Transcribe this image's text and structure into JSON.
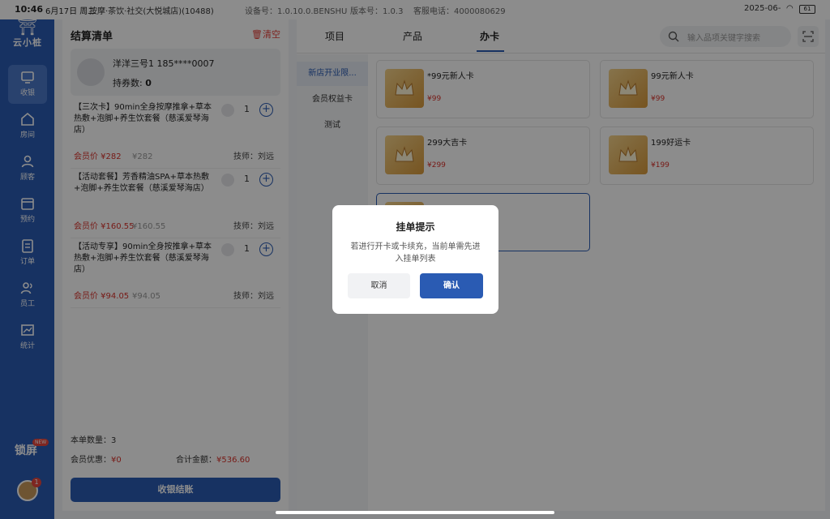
{
  "status_bar": {
    "time": "10:46",
    "date": "6月17日 周二",
    "store": "按摩·茶饮·社交(大悦城店)(10488)",
    "device": "设备号：1.0.10.0.BENSHU",
    "version": "版本号：1.0.3",
    "phone": "客服电话：4000080629",
    "right_date": "2025-06-",
    "battery": "61"
  },
  "sidebar": {
    "logo": "云小桩",
    "items": [
      {
        "label": "收银",
        "icon": "monitor-icon",
        "active": true
      },
      {
        "label": "房间",
        "icon": "home-icon"
      },
      {
        "label": "顾客",
        "icon": "person-icon"
      },
      {
        "label": "预约",
        "icon": "calendar-icon"
      },
      {
        "label": "订单",
        "icon": "clipboard-icon"
      },
      {
        "label": "员工",
        "icon": "staff-icon"
      },
      {
        "label": "统计",
        "icon": "chart-icon"
      }
    ],
    "bottom_label": "锁屏",
    "bottom_badge": "NEW",
    "avatar_badge": "1"
  },
  "order": {
    "title": "结算清单",
    "clear": "清空",
    "member": {
      "name": "洋洋三号1 185****0007",
      "points_label": "持券数:",
      "points_value": "0"
    },
    "items": [
      {
        "desc": "【三次卡】90min全身按摩推拿+草本热敷+泡脚+养生饮套餐（慈溪爱琴海店）",
        "qty": "1",
        "member_price": "会员价 ¥282",
        "orig_price": "¥282",
        "tech": "技师：刘远"
      },
      {
        "desc": "【活动套餐】芳香精油SPA+草本热敷+泡脚+养生饮套餐（慈溪爱琴海店）",
        "qty": "1",
        "member_price": "会员价 ¥160.55",
        "orig_price": "¥160.55",
        "tech": "技师：刘远"
      },
      {
        "desc": "【活动专享】90min全身按推拿+草本热敷+泡脚+养生饮套餐（慈溪爱琴海店）",
        "qty": "1",
        "member_price": "会员价 ¥94.05",
        "orig_price": "¥94.05",
        "tech": "技师：刘远"
      }
    ],
    "count_label": "本单数量：",
    "count_value": "3",
    "discount_label": "会员优惠：",
    "discount_value": "¥0",
    "total_label": "合计金额：",
    "total_value": "¥536.60",
    "checkout": "收银结账"
  },
  "main": {
    "tabs": [
      {
        "label": "项目"
      },
      {
        "label": "产品"
      },
      {
        "label": "办卡",
        "active": true
      }
    ],
    "search_placeholder": "输入品项关键字搜索",
    "categories": [
      {
        "label": "新店开业限...",
        "active": true
      },
      {
        "label": "会员权益卡"
      },
      {
        "label": "测试"
      }
    ],
    "cards": [
      {
        "title": "*99元新人卡",
        "price": "¥99"
      },
      {
        "title": "99元新人卡",
        "price": "¥99"
      },
      {
        "title": "299大吉卡",
        "price": "¥299"
      },
      {
        "title": "199好运卡",
        "price": "¥199"
      },
      {
        "title": "",
        "price": "",
        "selected": true
      }
    ]
  },
  "dialog": {
    "title": "挂单提示",
    "message": "若进行开卡或卡续充，当前单需先进入挂单列表",
    "cancel": "取消",
    "confirm": "确认"
  },
  "colors": {
    "brand": "#2a5bb3",
    "price": "#d9322b"
  }
}
